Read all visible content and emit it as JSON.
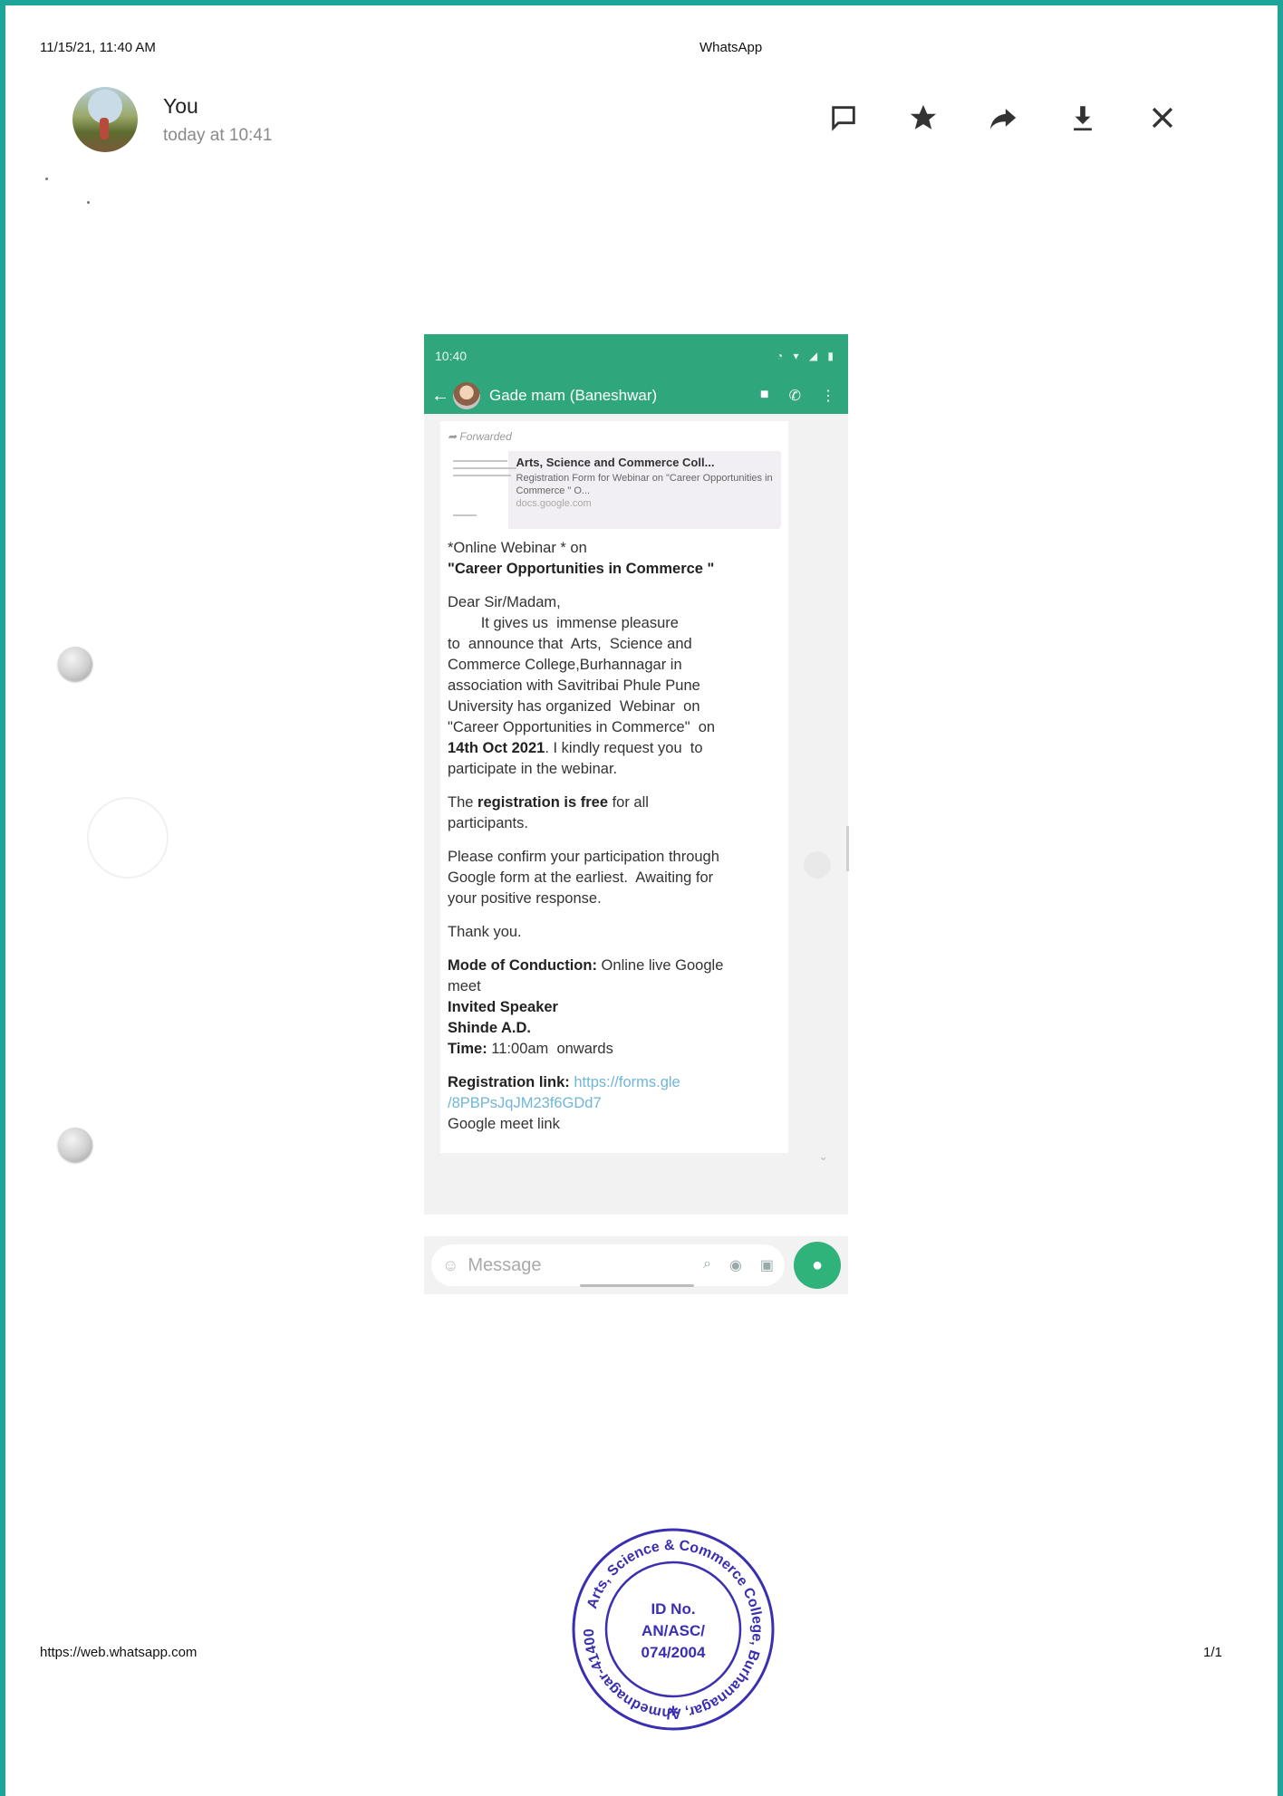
{
  "print": {
    "datetime": "11/15/21, 11:40 AM",
    "app_title": "WhatsApp",
    "url": "https://web.whatsapp.com",
    "page": "1/1"
  },
  "sender": {
    "name": "You",
    "time": "today at 10:41"
  },
  "toolbar": {
    "icons": [
      "reply-icon",
      "star-icon",
      "forward-icon",
      "download-icon",
      "close-icon"
    ]
  },
  "phone": {
    "status_time": "10:40",
    "contact_name": "Gade mam (Baneshwar)",
    "forwarded_label": "Forwarded",
    "link_preview": {
      "title": "Arts, Science and Commerce Coll...",
      "description": "Registration Form for Webinar on \"Career Opportunities in Commerce \" O...",
      "domain": "docs.google.com"
    },
    "message": {
      "line1": "*Online Webinar * on",
      "line2": "\"Career Opportunities in Commerce \"",
      "greeting": "Dear Sir/Madam,",
      "body1": "        It gives us  immense pleasure\nto  announce that  Arts,  Science and\nCommerce College,Burhannagar in\nassociation with Savitribai Phule Pune\nUniversity has organized  Webinar  on\n\"Career Opportunities in Commerce\"  on",
      "date_bold": "14th Oct 2021",
      "body1_end": ". I kindly request you  to\nparticipate in the webinar.",
      "reg_prefix": "The ",
      "reg_bold": "registration is free",
      "reg_suffix": " for all\nparticipants.",
      "confirm": "Please confirm your participation through\nGoogle form at the earliest.  Awaiting for\nyour positive response.",
      "thanks": "Thank you.",
      "mode_label": "Mode of Conduction:",
      "mode_value": " Online live Google\nmeet",
      "speaker_label": "Invited Speaker",
      "speaker_name": "Shinde A.D.",
      "time_label": "Time:",
      "time_value": " 11:00am  onwards",
      "reglink_label": "Registration link:",
      "reglink_url": "https://forms.gle\n/8PBPsJqJM23f6GDd7",
      "meet_label": "Google meet link"
    },
    "compose_placeholder": "Message"
  },
  "stamp": {
    "outer_text": "Arts, Science & Commerce College, Burhannagar, Ahmednagar-414002",
    "id_line1": "ID No.",
    "id_line2": "AN/ASC/",
    "id_line3": "074/2004"
  },
  "colors": {
    "whatsapp_green": "#2fa67c",
    "frame_teal": "#1ea59a",
    "stamp_ink": "#3a2fb0",
    "link_blue": "#6fb6d8"
  }
}
